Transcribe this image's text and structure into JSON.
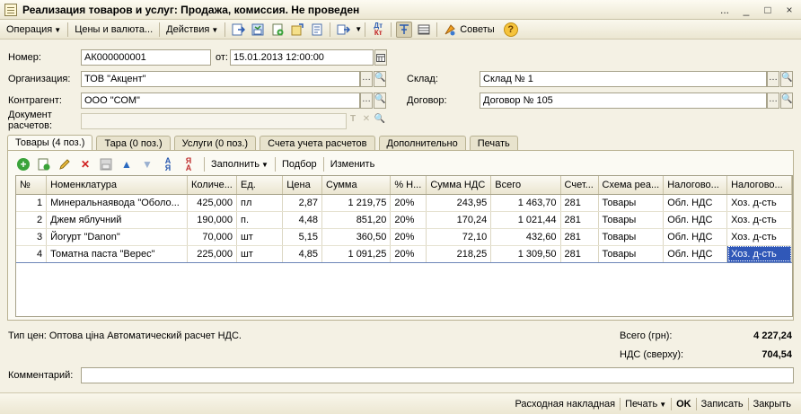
{
  "window": {
    "title": "Реализация товаров и услуг: Продажа, комиссия. Не проведен",
    "controls": [
      "...",
      "_",
      "□",
      "×"
    ]
  },
  "toolbar": {
    "operation": "Операция",
    "prices": "Цены и валюта...",
    "actions": "Действия",
    "dtkt": "Дт Кт",
    "tips": "Советы",
    "help": "?"
  },
  "header": {
    "number_label": "Номер:",
    "number": "АК000000001",
    "date_label": "от:",
    "date": "15.01.2013 12:00:00",
    "org_label": "Организация:",
    "org": "ТОВ \"Акцент\"",
    "warehouse_label": "Склад:",
    "warehouse": "Склад № 1",
    "counterparty_label": "Контрагент:",
    "counterparty": "ООО \"СОМ\"",
    "contract_label": "Договор:",
    "contract": "Договор № 105",
    "settlement_label_1": "Документ",
    "settlement_label_2": "расчетов:",
    "settlement": ""
  },
  "tabs": [
    {
      "label": "Товары (4 поз.)",
      "active": true
    },
    {
      "label": "Тара (0 поз.)",
      "active": false
    },
    {
      "label": "Услуги (0 поз.)",
      "active": false
    },
    {
      "label": "Счета учета расчетов",
      "active": false
    },
    {
      "label": "Дополнительно",
      "active": false
    },
    {
      "label": "Печать",
      "active": false
    }
  ],
  "grid_toolbar": {
    "fill": "Заполнить",
    "pick": "Подбор",
    "change": "Изменить"
  },
  "table": {
    "columns": [
      "№",
      "Номенклатура",
      "Количе...",
      "Ед.",
      "Цена",
      "Сумма",
      "% Н...",
      "Сумма НДС",
      "Всего",
      "Счет...",
      "Схема реа...",
      "Налогово...",
      "Налогово..."
    ],
    "rows": [
      [
        "1",
        "Минеральнаявода \"Оболо...",
        "425,000",
        "пл",
        "2,87",
        "1 219,75",
        "20%",
        "243,95",
        "1 463,70",
        "281",
        "Товары",
        "Обл. НДС",
        "Хоз. д-сть"
      ],
      [
        "2",
        "Джем яблучний",
        "190,000",
        "п.",
        "4,48",
        "851,20",
        "20%",
        "170,24",
        "1 021,44",
        "281",
        "Товары",
        "Обл. НДС",
        "Хоз. д-сть"
      ],
      [
        "3",
        "Йогурт \"Danon\"",
        "70,000",
        "шт",
        "5,15",
        "360,50",
        "20%",
        "72,10",
        "432,60",
        "281",
        "Товары",
        "Обл. НДС",
        "Хоз. д-сть"
      ],
      [
        "4",
        "Томатна паста \"Верес\"",
        "225,000",
        "шт",
        "4,85",
        "1 091,25",
        "20%",
        "218,25",
        "1 309,50",
        "281",
        "Товары",
        "Обл. НДС",
        "Хоз. д-сть"
      ]
    ],
    "selected_row": 4
  },
  "summary": {
    "price_type": "Тип цен: Оптова ціна Автоматический расчет НДС.",
    "total_label": "Всего (грн):",
    "total": "4 227,24",
    "vat_label": "НДС (сверху):",
    "vat": "704,54"
  },
  "comment": {
    "label": "Комментарий:",
    "value": ""
  },
  "footer": {
    "invoice": "Расходная накладная",
    "print": "Печать",
    "ok": "OK",
    "save": "Записать",
    "close": "Закрыть"
  }
}
